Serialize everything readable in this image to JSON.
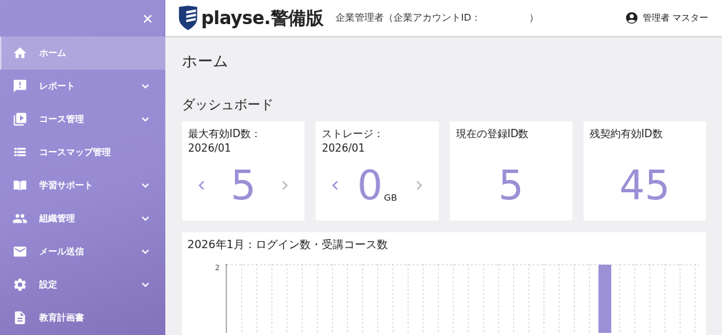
{
  "sidebar": {
    "close_label": "×",
    "items": [
      {
        "label": "ホーム",
        "selected": true,
        "expandable": false
      },
      {
        "label": "レポート",
        "selected": false,
        "expandable": true
      },
      {
        "label": "コース管理",
        "selected": false,
        "expandable": true
      },
      {
        "label": "コースマップ管理",
        "selected": false,
        "expandable": false
      },
      {
        "label": "学習サポート",
        "selected": false,
        "expandable": true
      },
      {
        "label": "組織管理",
        "selected": false,
        "expandable": true
      },
      {
        "label": "メール送信",
        "selected": false,
        "expandable": true
      },
      {
        "label": "設定",
        "selected": false,
        "expandable": true
      },
      {
        "label": "教育計画書",
        "selected": false,
        "expandable": false
      }
    ]
  },
  "header": {
    "logo": "playse.警備版",
    "account_label": "企業管理者（企業アカウントID：",
    "account_close": "）",
    "user": "管理者 マスター"
  },
  "page_title": "ホーム",
  "section_title": "ダッシュボード",
  "cards": [
    {
      "kind": "pager",
      "title": "最大有効ID数：\n2026/01",
      "value": "5",
      "prev_disabled": false,
      "next_disabled": true
    },
    {
      "kind": "pager",
      "title": "ストレージ：\n2026/01",
      "value": "0",
      "unit": "GB",
      "prev_disabled": false,
      "next_disabled": true
    },
    {
      "kind": "plain",
      "title": "現在の登録ID数",
      "value": "5"
    },
    {
      "kind": "plain",
      "title": "残契約有効ID数",
      "value": "45"
    }
  ],
  "chart_panel": {
    "title": "2026年1月：ログイン数・受講コース数",
    "y_tick_label": "2"
  }
}
